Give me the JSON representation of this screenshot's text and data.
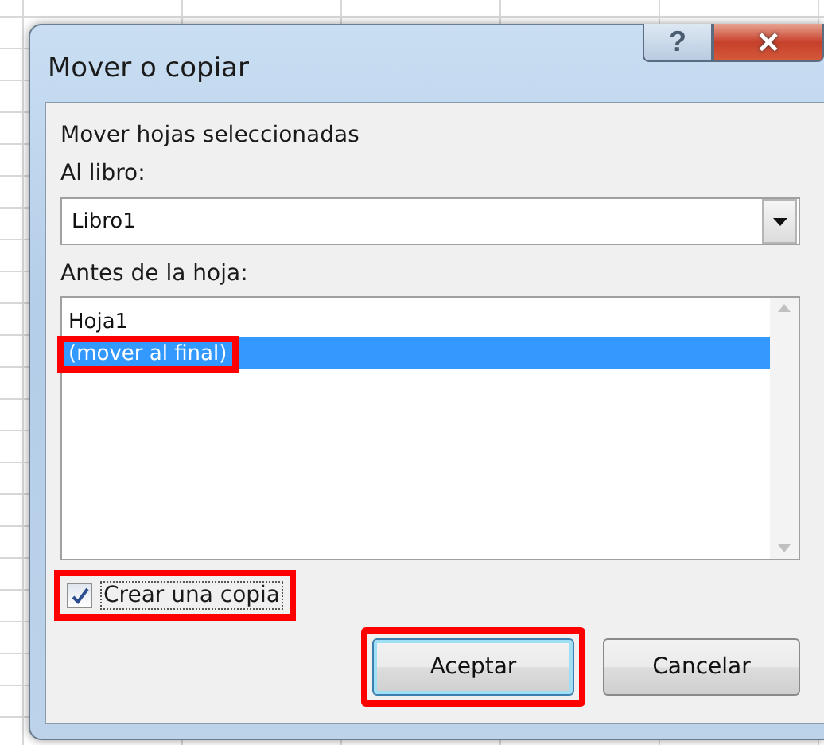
{
  "window": {
    "title": "Mover o copiar",
    "help_button": "?",
    "close_button": "✕"
  },
  "caption": "Mover hojas seleccionadas",
  "book": {
    "label": "Al libro:",
    "value": "Libro1"
  },
  "sheets": {
    "label": "Antes de la hoja:",
    "items": [
      {
        "label": "Hoja1",
        "selected": false,
        "highlighted": false
      },
      {
        "label": "(mover al final)",
        "selected": true,
        "highlighted": true
      }
    ]
  },
  "copy_option": {
    "label": "Crear una copia",
    "checked": true,
    "highlighted": true
  },
  "buttons": [
    {
      "label": "Aceptar",
      "default": true,
      "highlighted": true
    },
    {
      "label": "Cancelar",
      "default": false,
      "highlighted": false
    }
  ]
}
